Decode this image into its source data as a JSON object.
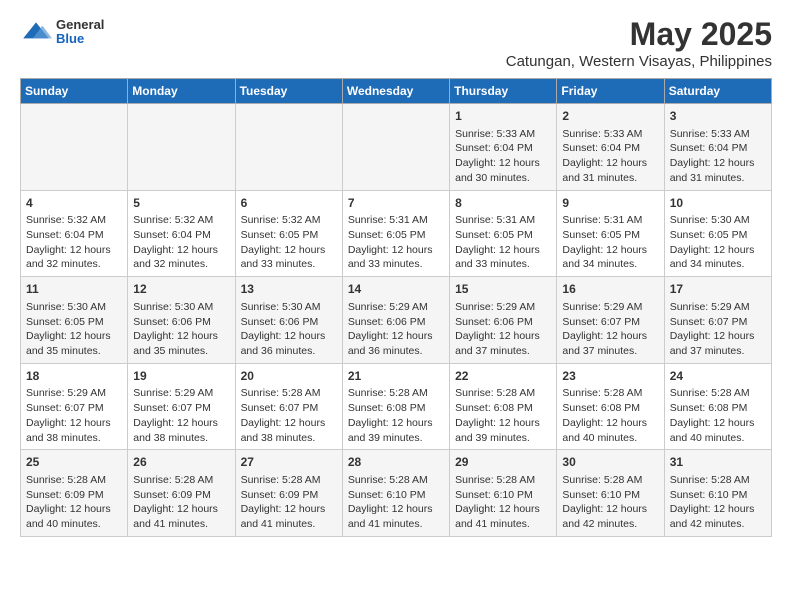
{
  "logo": {
    "general": "General",
    "blue": "Blue"
  },
  "title": "May 2025",
  "subtitle": "Catungan, Western Visayas, Philippines",
  "days_of_week": [
    "Sunday",
    "Monday",
    "Tuesday",
    "Wednesday",
    "Thursday",
    "Friday",
    "Saturday"
  ],
  "weeks": [
    [
      {
        "day": "",
        "info": ""
      },
      {
        "day": "",
        "info": ""
      },
      {
        "day": "",
        "info": ""
      },
      {
        "day": "",
        "info": ""
      },
      {
        "day": "1",
        "info": "Sunrise: 5:33 AM\nSunset: 6:04 PM\nDaylight: 12 hours and 30 minutes."
      },
      {
        "day": "2",
        "info": "Sunrise: 5:33 AM\nSunset: 6:04 PM\nDaylight: 12 hours and 31 minutes."
      },
      {
        "day": "3",
        "info": "Sunrise: 5:33 AM\nSunset: 6:04 PM\nDaylight: 12 hours and 31 minutes."
      }
    ],
    [
      {
        "day": "4",
        "info": "Sunrise: 5:32 AM\nSunset: 6:04 PM\nDaylight: 12 hours and 32 minutes."
      },
      {
        "day": "5",
        "info": "Sunrise: 5:32 AM\nSunset: 6:04 PM\nDaylight: 12 hours and 32 minutes."
      },
      {
        "day": "6",
        "info": "Sunrise: 5:32 AM\nSunset: 6:05 PM\nDaylight: 12 hours and 33 minutes."
      },
      {
        "day": "7",
        "info": "Sunrise: 5:31 AM\nSunset: 6:05 PM\nDaylight: 12 hours and 33 minutes."
      },
      {
        "day": "8",
        "info": "Sunrise: 5:31 AM\nSunset: 6:05 PM\nDaylight: 12 hours and 33 minutes."
      },
      {
        "day": "9",
        "info": "Sunrise: 5:31 AM\nSunset: 6:05 PM\nDaylight: 12 hours and 34 minutes."
      },
      {
        "day": "10",
        "info": "Sunrise: 5:30 AM\nSunset: 6:05 PM\nDaylight: 12 hours and 34 minutes."
      }
    ],
    [
      {
        "day": "11",
        "info": "Sunrise: 5:30 AM\nSunset: 6:05 PM\nDaylight: 12 hours and 35 minutes."
      },
      {
        "day": "12",
        "info": "Sunrise: 5:30 AM\nSunset: 6:06 PM\nDaylight: 12 hours and 35 minutes."
      },
      {
        "day": "13",
        "info": "Sunrise: 5:30 AM\nSunset: 6:06 PM\nDaylight: 12 hours and 36 minutes."
      },
      {
        "day": "14",
        "info": "Sunrise: 5:29 AM\nSunset: 6:06 PM\nDaylight: 12 hours and 36 minutes."
      },
      {
        "day": "15",
        "info": "Sunrise: 5:29 AM\nSunset: 6:06 PM\nDaylight: 12 hours and 37 minutes."
      },
      {
        "day": "16",
        "info": "Sunrise: 5:29 AM\nSunset: 6:07 PM\nDaylight: 12 hours and 37 minutes."
      },
      {
        "day": "17",
        "info": "Sunrise: 5:29 AM\nSunset: 6:07 PM\nDaylight: 12 hours and 37 minutes."
      }
    ],
    [
      {
        "day": "18",
        "info": "Sunrise: 5:29 AM\nSunset: 6:07 PM\nDaylight: 12 hours and 38 minutes."
      },
      {
        "day": "19",
        "info": "Sunrise: 5:29 AM\nSunset: 6:07 PM\nDaylight: 12 hours and 38 minutes."
      },
      {
        "day": "20",
        "info": "Sunrise: 5:28 AM\nSunset: 6:07 PM\nDaylight: 12 hours and 38 minutes."
      },
      {
        "day": "21",
        "info": "Sunrise: 5:28 AM\nSunset: 6:08 PM\nDaylight: 12 hours and 39 minutes."
      },
      {
        "day": "22",
        "info": "Sunrise: 5:28 AM\nSunset: 6:08 PM\nDaylight: 12 hours and 39 minutes."
      },
      {
        "day": "23",
        "info": "Sunrise: 5:28 AM\nSunset: 6:08 PM\nDaylight: 12 hours and 40 minutes."
      },
      {
        "day": "24",
        "info": "Sunrise: 5:28 AM\nSunset: 6:08 PM\nDaylight: 12 hours and 40 minutes."
      }
    ],
    [
      {
        "day": "25",
        "info": "Sunrise: 5:28 AM\nSunset: 6:09 PM\nDaylight: 12 hours and 40 minutes."
      },
      {
        "day": "26",
        "info": "Sunrise: 5:28 AM\nSunset: 6:09 PM\nDaylight: 12 hours and 41 minutes."
      },
      {
        "day": "27",
        "info": "Sunrise: 5:28 AM\nSunset: 6:09 PM\nDaylight: 12 hours and 41 minutes."
      },
      {
        "day": "28",
        "info": "Sunrise: 5:28 AM\nSunset: 6:10 PM\nDaylight: 12 hours and 41 minutes."
      },
      {
        "day": "29",
        "info": "Sunrise: 5:28 AM\nSunset: 6:10 PM\nDaylight: 12 hours and 41 minutes."
      },
      {
        "day": "30",
        "info": "Sunrise: 5:28 AM\nSunset: 6:10 PM\nDaylight: 12 hours and 42 minutes."
      },
      {
        "day": "31",
        "info": "Sunrise: 5:28 AM\nSunset: 6:10 PM\nDaylight: 12 hours and 42 minutes."
      }
    ]
  ]
}
